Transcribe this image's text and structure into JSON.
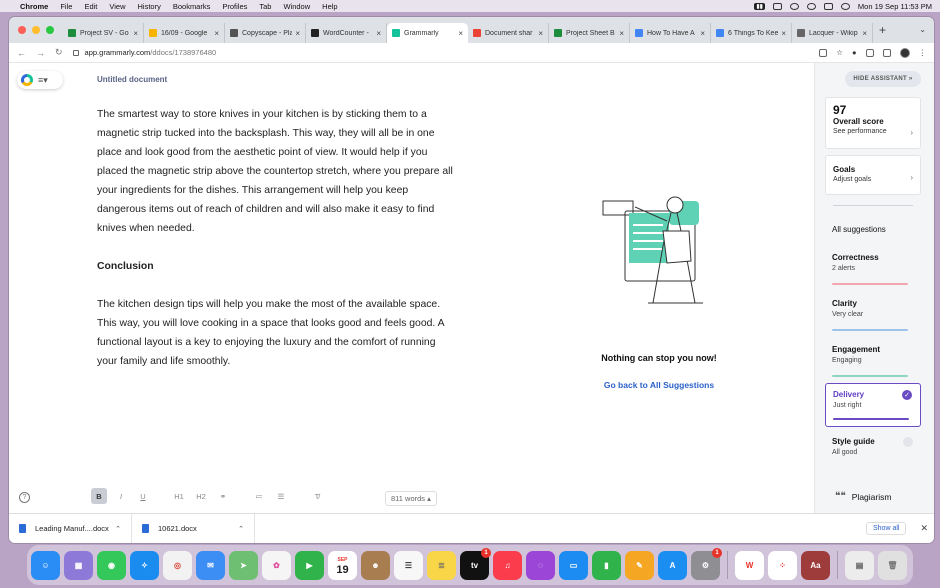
{
  "menubar": {
    "app_name": "Chrome",
    "items": [
      "File",
      "Edit",
      "View",
      "History",
      "Bookmarks",
      "Profiles",
      "Tab",
      "Window",
      "Help"
    ],
    "badge": "",
    "clock": "Mon 19 Sep  11:53 PM"
  },
  "tabs": [
    {
      "title": "Project SV - Go",
      "icon_color": "#1e8e3e",
      "icon": "sheets-icon"
    },
    {
      "title": "16/09 - Google",
      "icon_color": "#f4b400",
      "icon": "drive-icon"
    },
    {
      "title": "Copyscape - Pla",
      "icon_color": "#555555",
      "icon": "copyscape-icon"
    },
    {
      "title": "WordCounter -",
      "icon_color": "#222222",
      "icon": "wordcounter-icon"
    },
    {
      "title": "Grammarly",
      "icon_color": "#15c39a",
      "icon": "grammarly-icon",
      "active": true
    },
    {
      "title": "Document shar",
      "icon_color": "#ea4335",
      "icon": "gmail-icon"
    },
    {
      "title": "Project Sheet B",
      "icon_color": "#1e8e3e",
      "icon": "sheets-icon"
    },
    {
      "title": "How To Have A",
      "icon_color": "#4285f4",
      "icon": "docs-icon"
    },
    {
      "title": "6 Things To Kee",
      "icon_color": "#4285f4",
      "icon": "docs-icon"
    },
    {
      "title": "Lacquer - Wikip",
      "icon_color": "#666666",
      "icon": "wikipedia-icon"
    }
  ],
  "address": {
    "domain": "app.grammarly.com",
    "path": "/ddocs/1738976480"
  },
  "document": {
    "title": "Untitled document",
    "paragraph1": "The smartest way to store knives in your kitchen is by sticking them to a magnetic strip tucked into the backsplash. This way, they will all be in one place and look good from the aesthetic point of view. It would help if you placed the magnetic strip above the countertop stretch, where you prepare all your ingredients for the dishes. This arrangement will help you keep dangerous items out of reach of children and will also make it easy to find knives when needed.",
    "heading": "Conclusion",
    "paragraph2": "The kitchen design tips will help you make the most of the available space. This way, you will love cooking in a space that looks good and feels good. A functional layout is a key to enjoying the luxury and the comfort of running your family and life smoothly."
  },
  "center": {
    "message": "Nothing can stop you now!",
    "link": "Go back to All Suggestions"
  },
  "toolbar": {
    "bold": "B",
    "italic": "I",
    "underline": "U",
    "h1": "H1",
    "h2": "H2",
    "word_count": "811 words"
  },
  "sidebar": {
    "hide_label": "HIDE ASSISTANT",
    "score": "97",
    "score_label": "Overall score",
    "score_link": "See performance",
    "goals_label": "Goals",
    "goals_link": "Adjust goals",
    "all_suggestions": "All suggestions",
    "categories": [
      {
        "name": "Correctness",
        "status": "2 alerts",
        "color": "#f3a6ad"
      },
      {
        "name": "Clarity",
        "status": "Very clear",
        "color": "#9ec3ea"
      },
      {
        "name": "Engagement",
        "status": "Engaging",
        "color": "#8fd4c0"
      },
      {
        "name": "Delivery",
        "status": "Just right",
        "color": "#6a4bc4"
      },
      {
        "name": "Style guide",
        "status": "All good",
        "color": "#cfd3da"
      }
    ],
    "plagiarism": "Plagiarism"
  },
  "downloads": {
    "items": [
      "Leading Manuf....docx",
      "10621.docx"
    ],
    "show_all": "Show all"
  },
  "dock": {
    "calendar_month": "SEP",
    "calendar_day": "19",
    "tv_label": "tv",
    "tv_badge": "1",
    "settings_badge": "1",
    "dictionary_label": "Aa"
  }
}
